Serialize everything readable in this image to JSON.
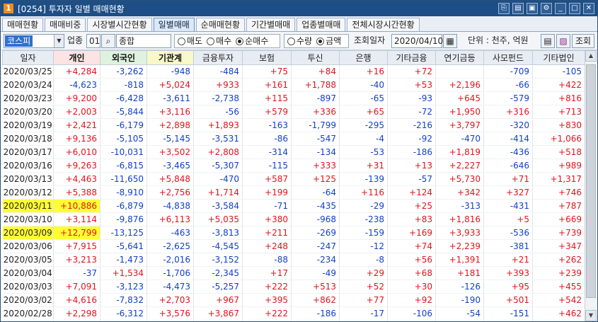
{
  "window": {
    "number": "1",
    "title": "[0254] 투자자 일별 매매현황"
  },
  "title_icons": [
    {
      "name": "link-icon",
      "glyph": "⎘"
    },
    {
      "name": "print-icon",
      "glyph": "▤"
    },
    {
      "name": "image-icon",
      "glyph": "▣"
    },
    {
      "name": "settings-icon",
      "glyph": "⚙"
    },
    {
      "name": "minimize-icon",
      "glyph": "_"
    },
    {
      "name": "maximize-icon",
      "glyph": "□"
    },
    {
      "name": "close-icon",
      "glyph": "✕"
    }
  ],
  "tabs": [
    "매매현황",
    "매매비중",
    "시장별시간현황",
    "일별매매",
    "순매매현황",
    "기간별매매",
    "업종별매매",
    "전체시장시간현황"
  ],
  "active_tab": 3,
  "toolbar": {
    "market": "코스피",
    "industry_label": "업종",
    "industry_code": "01",
    "search_icon": "⌕",
    "industry_name": "종합",
    "trade_type_options": [
      "매도",
      "매수",
      "순매수"
    ],
    "trade_type_selected": 2,
    "unit_type_options": [
      "수량",
      "금액"
    ],
    "unit_type_selected": 1,
    "date_label": "조회일자",
    "date_value": "2020/04/10",
    "calendar_icon": "▦",
    "unit_text": "단위 : 천주, 억원",
    "query_button": "조회"
  },
  "table": {
    "columns": [
      "일자",
      "개인",
      "외국인",
      "기관계",
      "금융투자",
      "보험",
      "투신",
      "은행",
      "기타금융",
      "연기금등",
      "사모펀드",
      "기타법인"
    ],
    "rows": [
      [
        "2020/03/25",
        "+4,284",
        "-3,262",
        "-948",
        "-484",
        "+75",
        "+84",
        "+16",
        "+72",
        "",
        "-709",
        "-105"
      ],
      [
        "2020/03/24",
        "-4,623",
        "-818",
        "+5,024",
        "+933",
        "+161",
        "+1,788",
        "-40",
        "+53",
        "+2,196",
        "-66",
        "+422"
      ],
      [
        "2020/03/23",
        "+9,200",
        "-6,428",
        "-3,611",
        "-2,738",
        "+115",
        "-897",
        "-65",
        "-93",
        "+645",
        "-579",
        "+816"
      ],
      [
        "2020/03/20",
        "+2,003",
        "-5,844",
        "+3,116",
        "-56",
        "+579",
        "+336",
        "+65",
        "-72",
        "+1,950",
        "+316",
        "+713"
      ],
      [
        "2020/03/19",
        "+2,421",
        "-6,179",
        "+2,898",
        "+1,893",
        "-163",
        "-1,799",
        "-295",
        "-216",
        "+3,797",
        "-320",
        "+830"
      ],
      [
        "2020/03/18",
        "+9,136",
        "-5,105",
        "-5,145",
        "-3,531",
        "-86",
        "-547",
        "-4",
        "-92",
        "-470",
        "-414",
        "+1,066"
      ],
      [
        "2020/03/17",
        "+6,010",
        "-10,031",
        "+3,502",
        "+2,808",
        "-314",
        "-134",
        "-53",
        "-186",
        "+1,819",
        "-436",
        "+518"
      ],
      [
        "2020/03/16",
        "+9,263",
        "-6,815",
        "-3,465",
        "-5,307",
        "-115",
        "+333",
        "+31",
        "+13",
        "+2,227",
        "-646",
        "+989"
      ],
      [
        "2020/03/13",
        "+4,463",
        "-11,650",
        "+5,848",
        "-470",
        "+587",
        "+125",
        "-139",
        "-57",
        "+5,730",
        "+71",
        "+1,317"
      ],
      [
        "2020/03/12",
        "+5,388",
        "-8,910",
        "+2,756",
        "+1,714",
        "+199",
        "-64",
        "+116",
        "+124",
        "+342",
        "+327",
        "+746"
      ],
      [
        "2020/03/11",
        "+10,886",
        "-6,879",
        "-4,838",
        "-3,584",
        "-71",
        "-435",
        "-29",
        "+25",
        "-313",
        "-431",
        "+787"
      ],
      [
        "2020/03/10",
        "+3,114",
        "-9,876",
        "+6,113",
        "+5,035",
        "+380",
        "-968",
        "-238",
        "+83",
        "+1,816",
        "+5",
        "+669"
      ],
      [
        "2020/03/09",
        "+12,799",
        "-13,125",
        "-463",
        "-3,813",
        "+211",
        "-269",
        "-159",
        "+169",
        "+3,933",
        "-536",
        "+739"
      ],
      [
        "2020/03/06",
        "+7,915",
        "-5,641",
        "-2,625",
        "-4,545",
        "+248",
        "-247",
        "-12",
        "+74",
        "+2,239",
        "-381",
        "+347"
      ],
      [
        "2020/03/05",
        "+3,213",
        "-1,473",
        "-2,016",
        "-3,152",
        "-88",
        "-234",
        "-8",
        "+56",
        "+1,391",
        "+21",
        "+262"
      ],
      [
        "2020/03/04",
        "-37",
        "+1,534",
        "-1,706",
        "-2,345",
        "+17",
        "-49",
        "+29",
        "+68",
        "+181",
        "+393",
        "+239"
      ],
      [
        "2020/03/03",
        "+7,091",
        "-3,123",
        "-4,473",
        "-5,257",
        "+222",
        "+513",
        "+52",
        "+30",
        "-126",
        "+95",
        "+455"
      ],
      [
        "2020/03/02",
        "+4,616",
        "-7,832",
        "+2,703",
        "+967",
        "+395",
        "+862",
        "+77",
        "+92",
        "-190",
        "+501",
        "+542"
      ],
      [
        "2020/02/28",
        "+2,298",
        "-6,312",
        "+3,576",
        "+3,867",
        "+222",
        "-186",
        "-17",
        "-106",
        "-54",
        "-151",
        "+462"
      ],
      [
        "2020/02/27",
        "+3,465",
        "-3,985",
        "-20",
        "-1,411",
        "+132",
        "+407",
        "+19",
        "+42",
        "+849",
        "-57",
        "+523"
      ]
    ],
    "highlighted_rows": [
      10,
      12
    ]
  },
  "colors": {
    "positive": "#e0141e",
    "negative": "#1340c9",
    "highlight": "#ffff33",
    "titlebar": "#1d4e86"
  }
}
